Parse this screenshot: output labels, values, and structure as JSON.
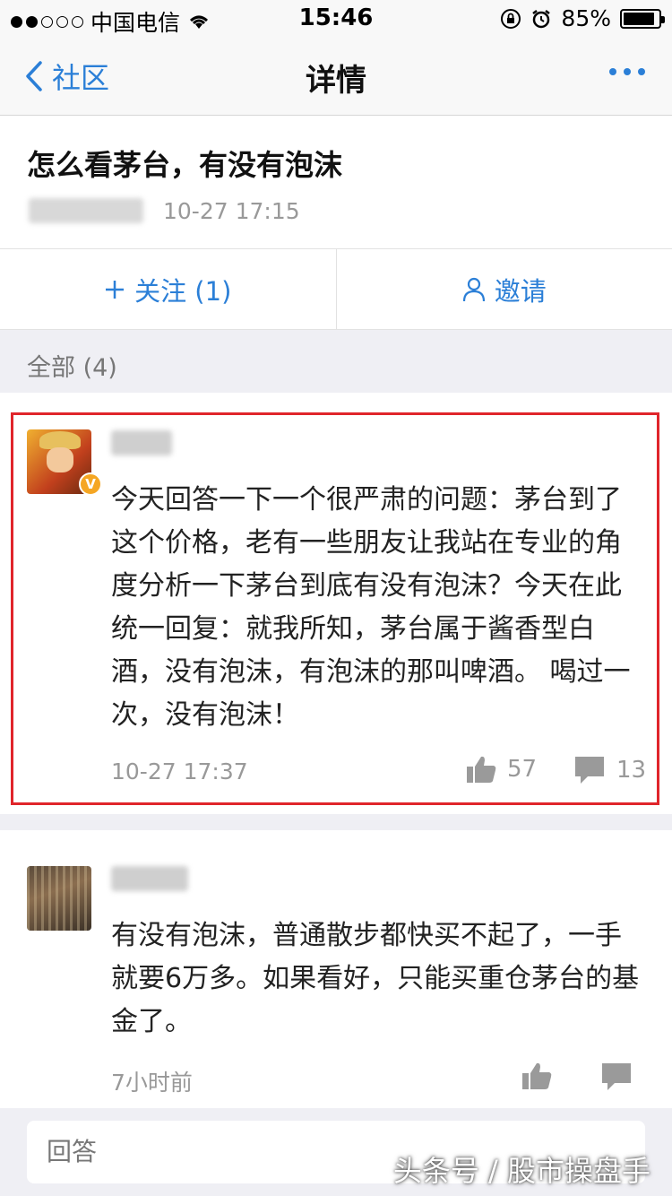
{
  "status_bar": {
    "carrier": "中国电信",
    "time": "15:46",
    "battery": "85%"
  },
  "nav": {
    "back_label": "社区",
    "title": "详情"
  },
  "post": {
    "question": "怎么看茅台，有没有泡沫",
    "time": "10-27 17:15"
  },
  "actions": {
    "follow_label": "关注 (1)",
    "invite_label": "邀请"
  },
  "section": {
    "all_label": "全部 (4)"
  },
  "answers": [
    {
      "body": "今天回答一下一个很严肃的问题：茅台到了这个价格，老有一些朋友让我站在专业的角度分析一下茅台到底有没有泡沫？今天在此统一回复：就我所知，茅台属于酱香型白酒，没有泡沫，有泡沫的那叫啤酒。 喝过一次，没有泡沫！",
      "time": "10-27 17:37",
      "likes": "57",
      "comments": "13",
      "badge": "V"
    },
    {
      "body": "有没有泡沫，普通散步都快买不起了，一手就要6万多。如果看好，只能买重仓茅台的基金了。",
      "time": "7小时前"
    }
  ],
  "reply": {
    "placeholder": "回答"
  },
  "watermark": "头条号 / 股市操盘手",
  "colors": {
    "accent": "#2b7fd7",
    "highlight": "#e0252b",
    "muted": "#999999"
  }
}
